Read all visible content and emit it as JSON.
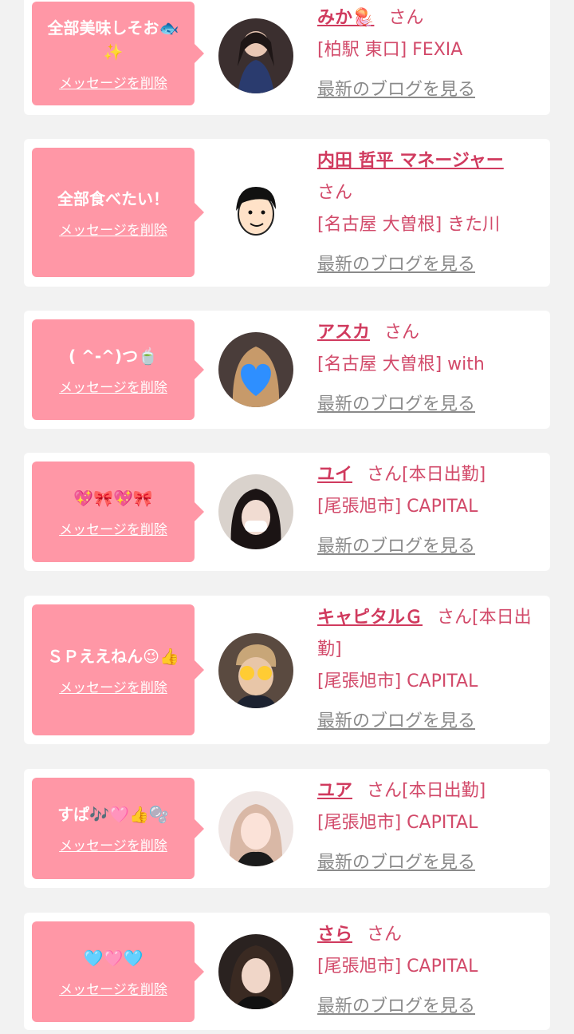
{
  "colors": {
    "background": "#f2f2f2",
    "card": "#ffffff",
    "bubble": "#ff97a6",
    "accent": "#d03a5e",
    "link_gray": "#8a8a8a"
  },
  "delete_label": "メッセージを削除",
  "blog_label": "最新のブログを見る",
  "messages": [
    {
      "message": "全部美味しそお🐟✨",
      "name": "みか🪼",
      "honorific": "さん",
      "status": "",
      "shop": "[柏駅 東口] FEXIA",
      "avatar_icon": "woman-photo-avatar"
    },
    {
      "message": "全部食べたい！",
      "name": "内田 哲平 マネージャー",
      "honorific": "さん",
      "status": "",
      "shop": "[名古屋 大曽根] きた川",
      "avatar_icon": "cartoon-man-avatar"
    },
    {
      "message": "( ^-^)つ🍵",
      "name": "アスカ",
      "honorific": "さん",
      "status": "",
      "shop": "[名古屋 大曽根] with",
      "avatar_icon": "heart-face-avatar"
    },
    {
      "message": "💖🎀💖🎀",
      "name": "ユイ",
      "honorific": "さん",
      "status": "[本日出勤]",
      "shop": "[尾張旭市] CAPITAL",
      "avatar_icon": "woman-photo-avatar"
    },
    {
      "message": "ＳＰええねん😉👍",
      "name": "キャピタルＧ",
      "honorific": "さん",
      "status": "[本日出勤]",
      "shop": "[尾張旭市] CAPITAL",
      "avatar_icon": "man-emoji-face-avatar"
    },
    {
      "message": "すぱ🎶🩷👍🫧",
      "name": "ユア",
      "honorific": "さん",
      "status": "[本日出勤]",
      "shop": "[尾張旭市] CAPITAL",
      "avatar_icon": "woman-photo-avatar"
    },
    {
      "message": "🩵🩷🩵",
      "name": "さら",
      "honorific": "さん",
      "status": "",
      "shop": "[尾張旭市] CAPITAL",
      "avatar_icon": "woman-photo-avatar"
    }
  ]
}
